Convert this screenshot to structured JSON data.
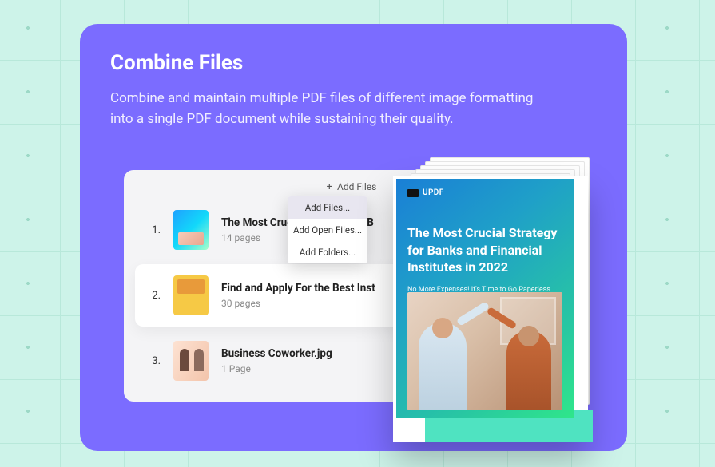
{
  "header": {
    "title": "Combine Files",
    "description": "Combine and maintain multiple PDF files of different image formatting into a single PDF document while sustaining their quality."
  },
  "toolbar": {
    "add_files_label": "Add Files"
  },
  "dropdown": {
    "items": [
      {
        "label": "Add Files...",
        "selected": true
      },
      {
        "label": "Add Open Files..."
      },
      {
        "label": "Add Folders..."
      }
    ]
  },
  "files": [
    {
      "num": "1.",
      "name": "The Most Crucial Strategy for B",
      "pages": "14 pages"
    },
    {
      "num": "2.",
      "name": "Find and Apply For the Best Inst",
      "pages": "30 pages"
    },
    {
      "num": "3.",
      "name": "Business Coworker.jpg",
      "pages": "1 Page"
    }
  ],
  "preview": {
    "brand": "UPDF",
    "doc_title": "The Most Crucial Strategy for Banks and Financial Institutes in 2022",
    "doc_subtitle": "No More Expenses! It's Time to Go Paperless"
  }
}
